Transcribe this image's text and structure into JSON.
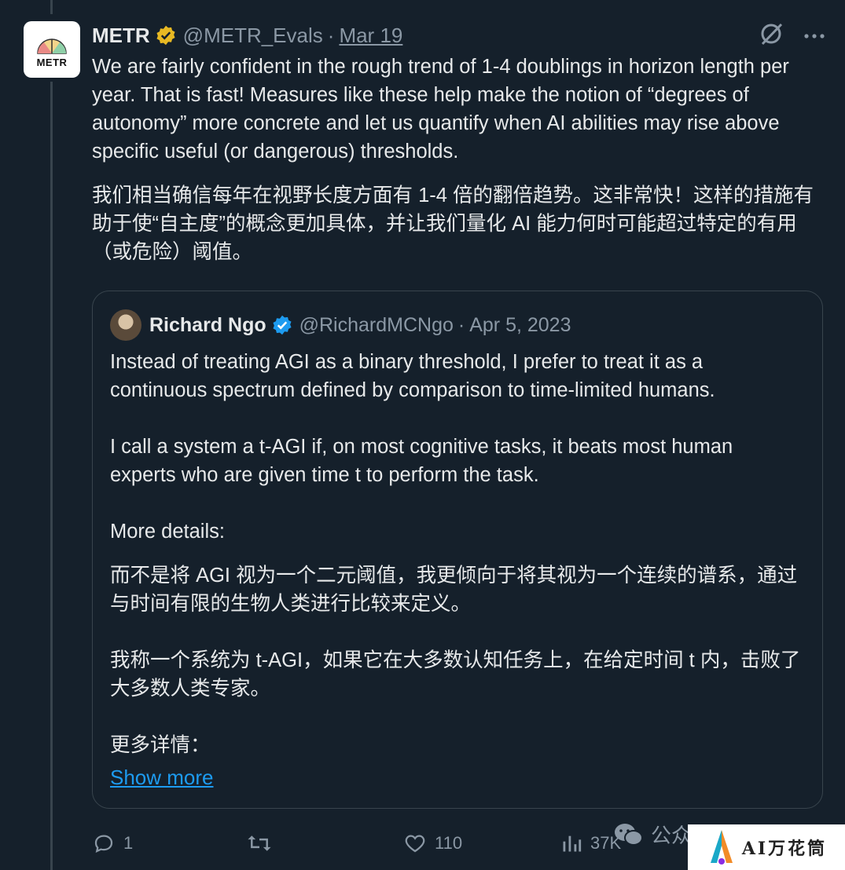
{
  "tweet": {
    "author_name": "METR",
    "handle": "@METR_Evals",
    "separator": "·",
    "date": "Mar 19",
    "avatar_logo_text": "METR",
    "text_en": "We are fairly confident in the rough trend of 1-4 doublings in horizon length per year. That is fast! Measures like these help make the notion of “degrees of autonomy” more concrete and let us quantify when AI abilities may rise above specific useful (or dangerous) thresholds.",
    "text_zh": "我们相当确信每年在视野长度方面有 1-4 倍的翻倍趋势。这非常快！这样的措施有助于使“自主度”的概念更加具体，并让我们量化 AI 能力何时可能超过特定的有用（或危险）阈值。"
  },
  "quote": {
    "author_name": "Richard Ngo",
    "handle": "@RichardMCNgo",
    "separator": "·",
    "date": "Apr 5, 2023",
    "paragraphs": [
      "Instead of treating AGI as a binary threshold, I prefer to treat it as a continuous spectrum defined by comparison to time-limited humans.",
      "I call a system a t-AGI if, on most cognitive tasks, it beats most human experts who are given time t to perform the task.",
      "More details:",
      "而不是将 AGI 视为一个二元阈值，我更倾向于将其视为一个连续的谱系，通过与时间有限的生物人类进行比较来定义。",
      "我称一个系统为 t-AGI，如果它在大多数认知任务上，在给定时间 t 内，击败了大多数人类专家。",
      "更多详情："
    ],
    "show_more": "Show more"
  },
  "actions": {
    "replies": "1",
    "retweets": "",
    "likes": "110",
    "views": "37K"
  },
  "watermark": {
    "wechat_text": "公众",
    "brand_text": "AI万花筒"
  },
  "colors": {
    "background": "#15202b",
    "text": "#e7e9ea",
    "muted": "#8b98a5",
    "link": "#1d9bf0",
    "verified_gold": "#e8b923",
    "verified_blue": "#1d9bf0",
    "border": "#38444d"
  }
}
